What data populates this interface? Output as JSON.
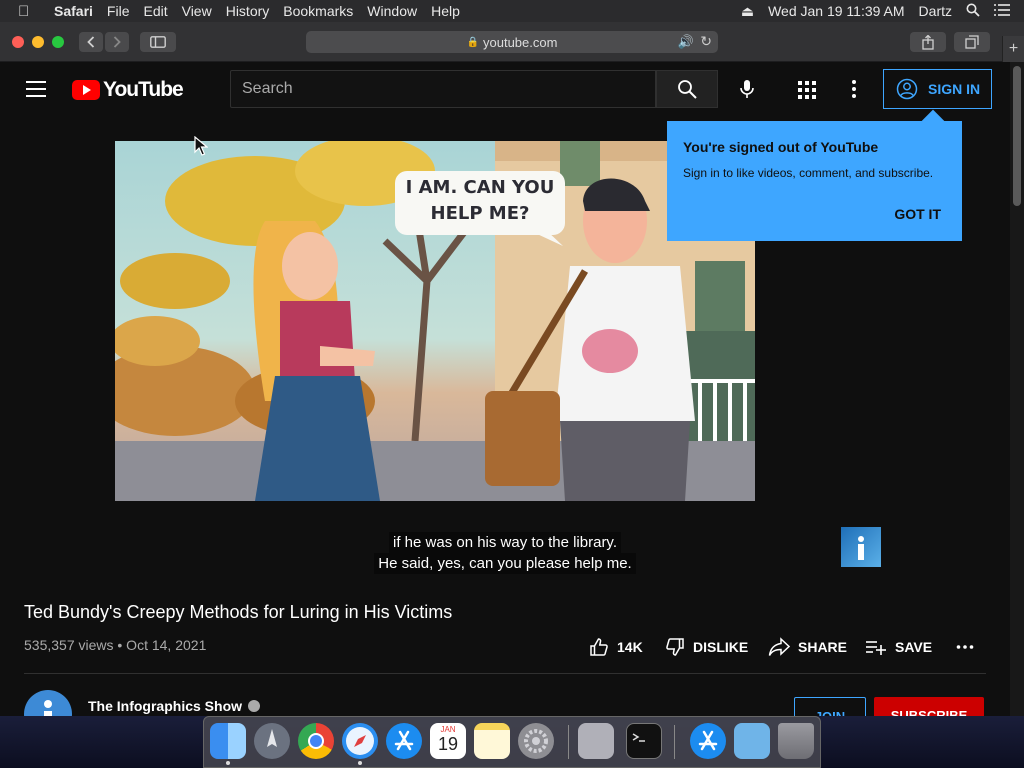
{
  "menubar": {
    "app_name": "Safari",
    "items": [
      "File",
      "Edit",
      "View",
      "History",
      "Bookmarks",
      "Window",
      "Help"
    ],
    "datetime": "Wed Jan 19  11:39 AM",
    "user": "Dartz"
  },
  "browser": {
    "url": "youtube.com"
  },
  "youtube": {
    "logo_text": "YouTube",
    "search_placeholder": "Search",
    "sign_in": "SIGN IN",
    "tooltip": {
      "title": "You're signed out of YouTube",
      "body": "Sign in to like videos, comment, and subscribe.",
      "action": "GOT IT"
    },
    "player": {
      "speech_bubble": "I AM. CAN YOU HELP ME?",
      "caption_line1": "if he was on his way to the library.",
      "caption_line2": "He said, yes, can you please help me."
    },
    "video": {
      "title": "Ted Bundy's Creepy Methods for Luring in His Victims",
      "meta": "535,357 views • Oct 14, 2021",
      "likes": "14K",
      "dislike": "DISLIKE",
      "share": "SHARE",
      "save": "SAVE"
    },
    "channel": {
      "name": "The Infographics Show",
      "join": "JOIN",
      "subscribe": "SUBSCRIBE"
    }
  },
  "dock": {
    "calendar_month": "JAN",
    "calendar_day": "19"
  },
  "colors": {
    "accent_blue": "#3ea6ff",
    "youtube_red": "#ff0000",
    "subscribe_red": "#cc0000",
    "page_bg": "#0f0f0f"
  },
  "icons": [
    "apple-icon",
    "eject-icon",
    "search-icon",
    "control-center-icon",
    "back-icon",
    "forward-icon",
    "sidebar-icon",
    "lock-icon",
    "speaker-icon",
    "reload-icon",
    "share-icon",
    "tabs-icon",
    "plus-icon",
    "menu-icon",
    "mic-icon",
    "apps-icon",
    "more-icon",
    "account-icon",
    "like-icon",
    "dislike-icon",
    "share-arrow-icon",
    "playlist-add-icon",
    "verified-icon"
  ]
}
